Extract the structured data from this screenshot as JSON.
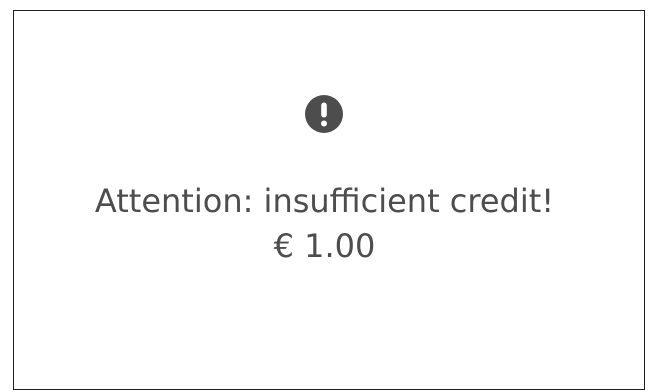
{
  "alert": {
    "icon": "exclamation-circle-icon",
    "message": "Attention: insufficient credit!",
    "amount": "€ 1.00"
  },
  "colors": {
    "text": "#4d4d4d",
    "icon": "#4d4d4d",
    "border": "#1f1f1f",
    "background": "#ffffff"
  }
}
